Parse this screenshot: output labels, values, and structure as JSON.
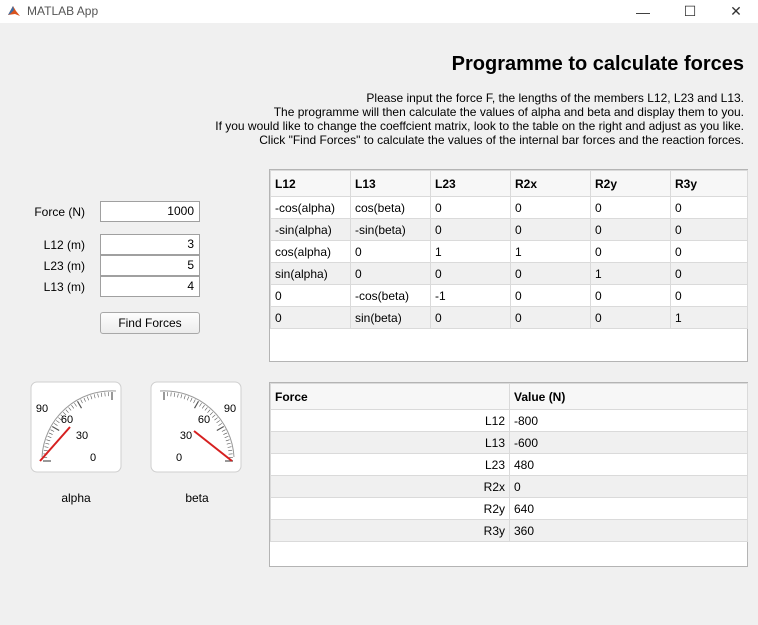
{
  "window": {
    "title": "MATLAB App",
    "minimize_glyph": "—",
    "maximize_glyph": "☐",
    "close_glyph": "✕"
  },
  "heading": "Programme to calculate forces",
  "instructions": [
    "Please input the force F, the lengths of the members L12, L23 and L13.",
    "The programme will then calculate the values of alpha and beta and display them to you.",
    "If you would like to change the coeffcient matrix, look to the table on the right and adjust as you like.",
    "Click \"Find Forces\" to calculate the values of the internal bar forces and the reaction forces."
  ],
  "inputs": {
    "force": {
      "label": "Force (N)",
      "value": "1000"
    },
    "l12": {
      "label": "L12 (m)",
      "value": "3"
    },
    "l23": {
      "label": "L23 (m)",
      "value": "5"
    },
    "l13": {
      "label": "L13 (m)",
      "value": "4"
    }
  },
  "find_forces_label": "Find Forces",
  "matrix_table": {
    "headers": [
      "L12",
      "L13",
      "L23",
      "R2x",
      "R2y",
      "R3y"
    ],
    "rows": [
      [
        "-cos(alpha)",
        "cos(beta)",
        "0",
        "0",
        "0",
        "0"
      ],
      [
        "-sin(alpha)",
        "-sin(beta)",
        "0",
        "0",
        "0",
        "0"
      ],
      [
        "cos(alpha)",
        "0",
        "1",
        "1",
        "0",
        "0"
      ],
      [
        "sin(alpha)",
        "0",
        "0",
        "0",
        "1",
        "0"
      ],
      [
        "0",
        "-cos(beta)",
        "-1",
        "0",
        "0",
        "0"
      ],
      [
        "0",
        "sin(beta)",
        "0",
        "0",
        "0",
        "1"
      ]
    ]
  },
  "results_table": {
    "headers": [
      "Force",
      "Value (N)"
    ],
    "rows": [
      [
        "L12",
        "-800"
      ],
      [
        "L13",
        "-600"
      ],
      [
        "L23",
        "480"
      ],
      [
        "R2x",
        "0"
      ],
      [
        "R2y",
        "640"
      ],
      [
        "R3y",
        "360"
      ]
    ]
  },
  "gauges": {
    "alpha": {
      "caption": "alpha",
      "ticks": [
        "90",
        "60",
        "30",
        "0"
      ],
      "value_deg": 53.13,
      "max_deg": 90,
      "needle_color": "#d62020"
    },
    "beta": {
      "caption": "beta",
      "ticks": [
        "0",
        "30",
        "60",
        "90"
      ],
      "value_deg": 36.87,
      "max_deg": 90,
      "needle_color": "#d62020"
    }
  }
}
